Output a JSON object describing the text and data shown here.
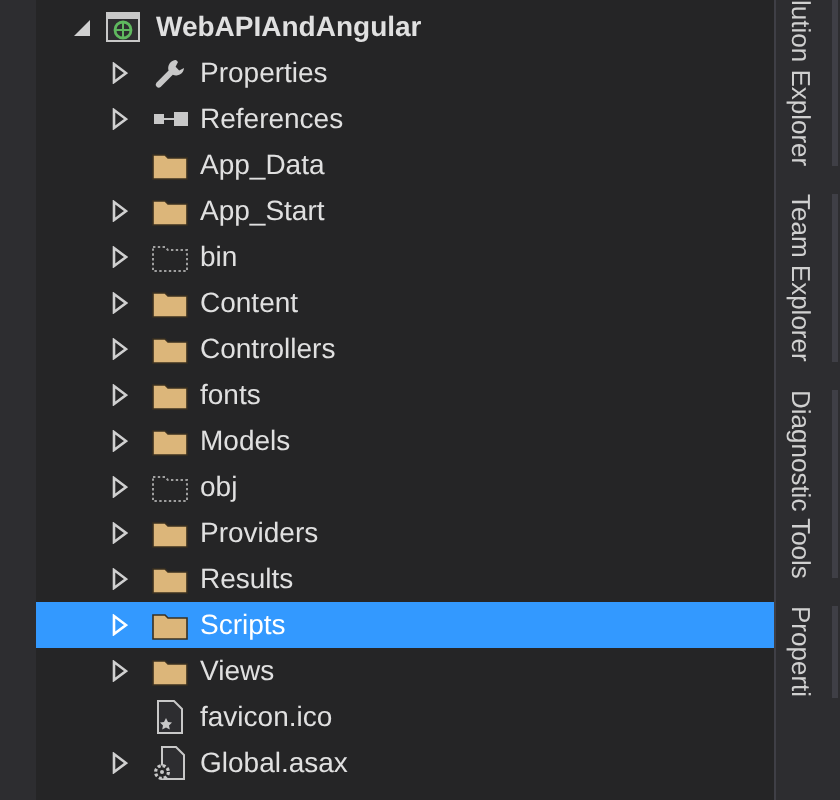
{
  "project": {
    "label": "WebAPIAndAngular",
    "expanded": true
  },
  "items": [
    {
      "label": "Properties",
      "kind": "wrench",
      "expandable": true,
      "selected": false
    },
    {
      "label": "References",
      "kind": "references",
      "expandable": true,
      "selected": false
    },
    {
      "label": "App_Data",
      "kind": "folder",
      "expandable": false,
      "selected": false
    },
    {
      "label": "App_Start",
      "kind": "folder",
      "expandable": true,
      "selected": false
    },
    {
      "label": "bin",
      "kind": "hidden-folder",
      "expandable": true,
      "selected": false
    },
    {
      "label": "Content",
      "kind": "folder",
      "expandable": true,
      "selected": false
    },
    {
      "label": "Controllers",
      "kind": "folder",
      "expandable": true,
      "selected": false
    },
    {
      "label": "fonts",
      "kind": "folder",
      "expandable": true,
      "selected": false
    },
    {
      "label": "Models",
      "kind": "folder",
      "expandable": true,
      "selected": false
    },
    {
      "label": "obj",
      "kind": "hidden-folder",
      "expandable": true,
      "selected": false
    },
    {
      "label": "Providers",
      "kind": "folder",
      "expandable": true,
      "selected": false
    },
    {
      "label": "Results",
      "kind": "folder",
      "expandable": true,
      "selected": false
    },
    {
      "label": "Scripts",
      "kind": "folder",
      "expandable": true,
      "selected": true
    },
    {
      "label": "Views",
      "kind": "folder",
      "expandable": true,
      "selected": false
    },
    {
      "label": "favicon.ico",
      "kind": "image-file",
      "expandable": false,
      "selected": false
    },
    {
      "label": "Global.asax",
      "kind": "config-file",
      "expandable": true,
      "selected": false
    }
  ],
  "side_tabs": [
    "lution Explorer",
    "Team Explorer",
    "Diagnostic Tools",
    "Properti"
  ]
}
